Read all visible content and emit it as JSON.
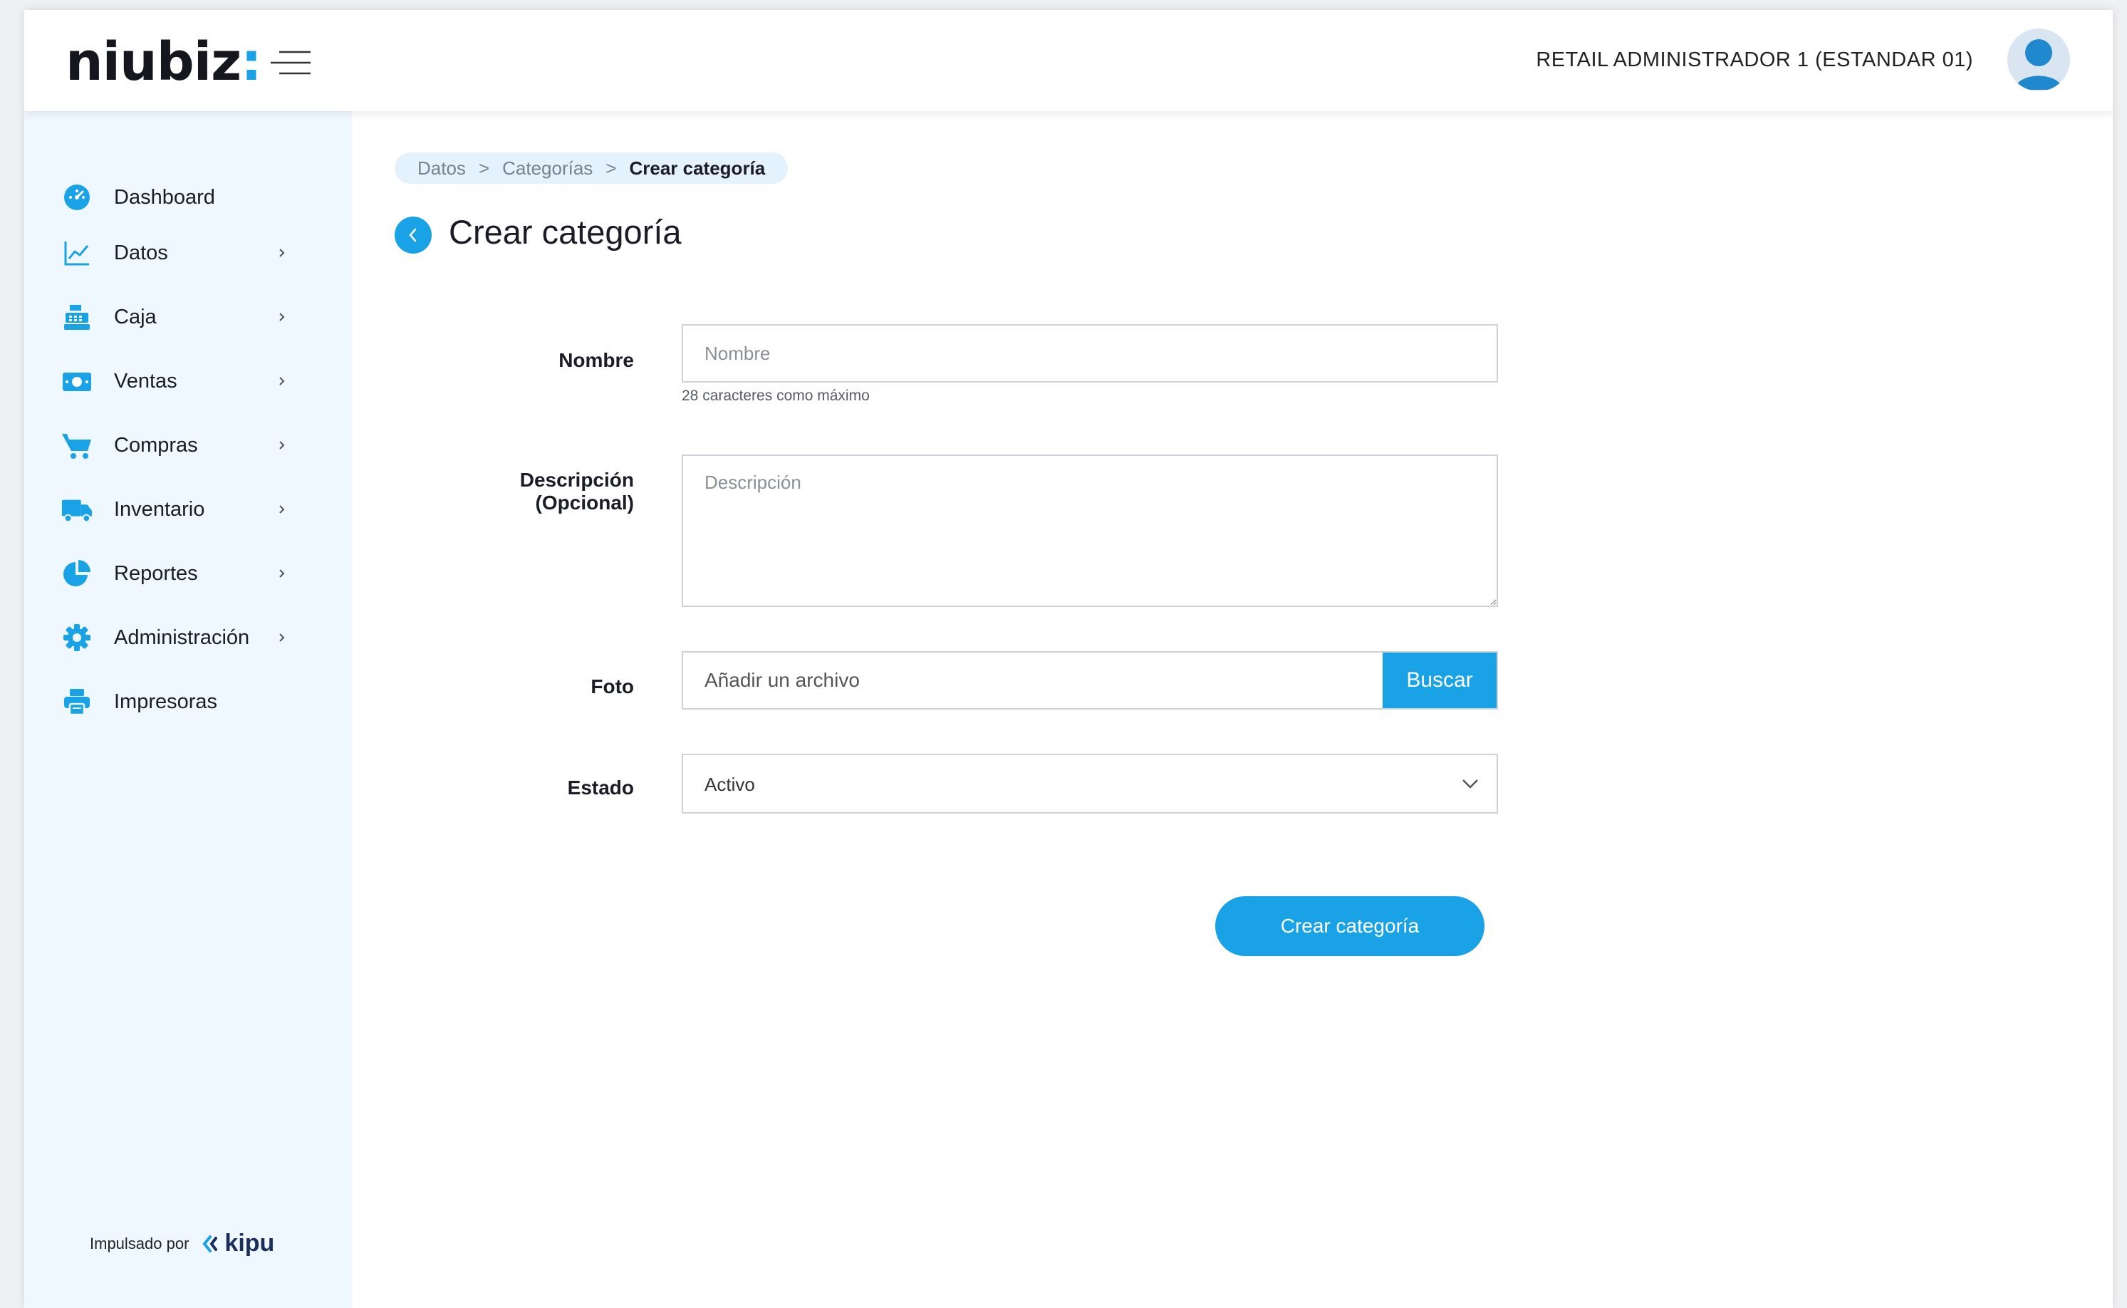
{
  "brand": {
    "name": "niubiz",
    "colon": ":",
    "accent": "#1aa2e6"
  },
  "header": {
    "user": "RETAIL ADMINISTRADOR 1 (ESTANDAR 01)"
  },
  "sidebar": {
    "items": [
      {
        "label": "Dashboard",
        "icon": "dashboard-icon",
        "submenu": false
      },
      {
        "label": "Datos",
        "icon": "chart-line-icon",
        "submenu": true
      },
      {
        "label": "Caja",
        "icon": "cash-register-icon",
        "submenu": true
      },
      {
        "label": "Ventas",
        "icon": "money-bill-icon",
        "submenu": true
      },
      {
        "label": "Compras",
        "icon": "cart-icon",
        "submenu": true
      },
      {
        "label": "Inventario",
        "icon": "truck-icon",
        "submenu": true
      },
      {
        "label": "Reportes",
        "icon": "pie-chart-icon",
        "submenu": true
      },
      {
        "label": "Administración",
        "icon": "gear-icon",
        "submenu": true
      },
      {
        "label": "Impresoras",
        "icon": "printer-icon",
        "submenu": false
      }
    ],
    "powered_by": "Impulsado por",
    "powered_brand": "kipu"
  },
  "breadcrumb": {
    "items": [
      "Datos",
      "Categorías",
      "Crear categoría"
    ],
    "separator": ">"
  },
  "page": {
    "title": "Crear categoría"
  },
  "form": {
    "name": {
      "label": "Nombre",
      "placeholder": "Nombre",
      "value": "",
      "hint": "28 caracteres como máximo"
    },
    "description": {
      "label_line1": "Descripción",
      "label_line2": "(Opcional)",
      "placeholder": "Descripción",
      "value": ""
    },
    "photo": {
      "label": "Foto",
      "placeholder": "Añadir un archivo",
      "button": "Buscar"
    },
    "status": {
      "label": "Estado",
      "value": "Activo"
    },
    "submit": "Crear categoría"
  }
}
